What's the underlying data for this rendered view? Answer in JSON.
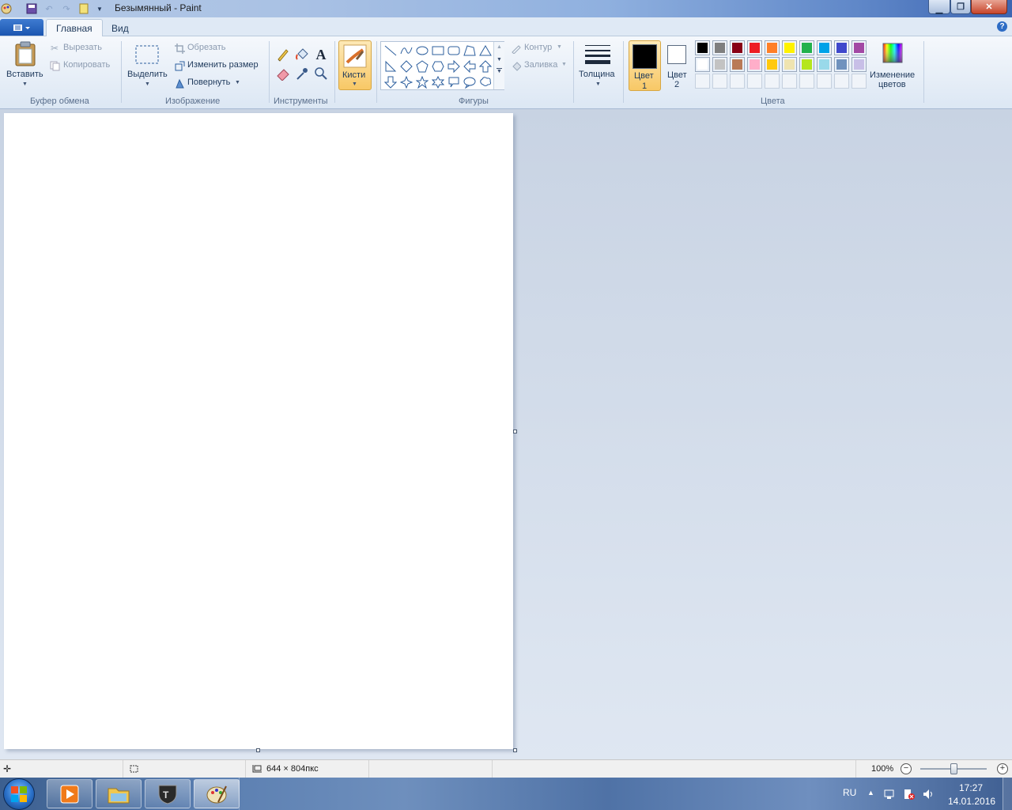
{
  "window": {
    "title": "Безымянный - Paint",
    "controls": [
      "minimize",
      "maximize",
      "close"
    ]
  },
  "ribbon_tabs": {
    "file_menu": "file-menu",
    "home": "Главная",
    "view": "Вид"
  },
  "clipboard": {
    "paste": "Вставить",
    "cut": "Вырезать",
    "copy": "Копировать",
    "group": "Буфер обмена"
  },
  "image": {
    "select": "Выделить",
    "crop": "Обрезать",
    "resize": "Изменить размер",
    "rotate": "Повернуть",
    "group": "Изображение"
  },
  "tools": {
    "group": "Инструменты",
    "items": [
      "pencil",
      "fill",
      "text",
      "eraser",
      "color-picker",
      "magnifier"
    ]
  },
  "brushes": {
    "label": "Кисти"
  },
  "shapes": {
    "group": "Фигуры",
    "outline": "Контур",
    "fill": "Заливка",
    "items": [
      "line",
      "curve",
      "oval",
      "rectangle",
      "rounded-rectangle",
      "polygon",
      "triangle",
      "right-triangle",
      "diamond",
      "pentagon",
      "hexagon",
      "right-arrow",
      "left-arrow",
      "up-arrow",
      "down-arrow",
      "four-point-star",
      "five-point-star",
      "six-point-star",
      "rounded-callout",
      "oval-callout",
      "cloud-callout"
    ]
  },
  "size": {
    "label": "Толщина"
  },
  "colors": {
    "group": "Цвета",
    "color1_line1": "Цвет",
    "color1_line2": "1",
    "color2_line1": "Цвет",
    "color2_line2": "2",
    "color1_value": "#000000",
    "color2_value": "#ffffff",
    "edit_line1": "Изменение",
    "edit_line2": "цветов",
    "palette_row1": [
      "#000000",
      "#7f7f7f",
      "#880015",
      "#ed1c24",
      "#ff7f27",
      "#fff200",
      "#22b14c",
      "#00a2e8",
      "#3f48cc",
      "#a349a4"
    ],
    "palette_row2": [
      "#ffffff",
      "#c3c3c3",
      "#b97a57",
      "#ffaec9",
      "#ffc90e",
      "#efe4b0",
      "#b5e61d",
      "#99d9ea",
      "#7092be",
      "#c8bfe7"
    ]
  },
  "status": {
    "canvas_size": "644 × 804пкс",
    "zoom": "100%"
  },
  "taskbar": {
    "apps": [
      "media-player",
      "file-explorer",
      "world-of-tanks",
      "paint"
    ],
    "language": "RU",
    "time": "17:27",
    "date": "14.01.2016"
  }
}
